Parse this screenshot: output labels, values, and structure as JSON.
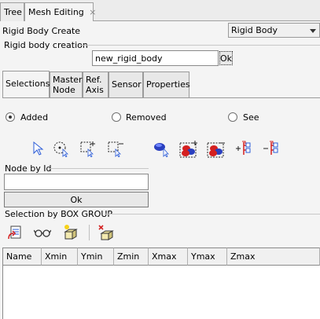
{
  "tabs": [
    {
      "label": "Tree"
    },
    {
      "label": "Mesh Editing",
      "close": "×"
    }
  ],
  "header": {
    "title": "Rigid Body Create",
    "type_select": {
      "value": "Rigid Body"
    }
  },
  "creation": {
    "group_label": "Rigid body creation",
    "name_value": "new_rigid_body",
    "ok_label": "Ok"
  },
  "subtabs": [
    {
      "label": "Selections"
    },
    {
      "label": "Master Node"
    },
    {
      "label": "Ref. Axis"
    },
    {
      "label": "Sensor"
    },
    {
      "label": "Properties"
    }
  ],
  "selection_mode": {
    "options": [
      {
        "label": "Added",
        "selected": true
      },
      {
        "label": "Removed",
        "selected": false
      },
      {
        "label": "See",
        "selected": false
      }
    ]
  },
  "toolbar_icons": [
    "select-arrow-icon",
    "select-point-icon",
    "box-add-icon",
    "box-remove-icon",
    "pick-part-icon",
    "add-part-icon",
    "remove-part-icon",
    "add-tree-icon",
    "remove-tree-icon"
  ],
  "node_by_id": {
    "label": "Node by Id",
    "input_value": "",
    "ok_label": "Ok"
  },
  "box_group": {
    "label": "Selection by BOX GROUP",
    "icons": [
      "import-box-icon",
      "view-box-icon",
      "new-box-icon",
      "delete-box-icon"
    ],
    "columns": [
      "Name",
      "Xmin",
      "Ymin",
      "Zmin",
      "Xmax",
      "Ymax",
      "Zmax"
    ],
    "rows": []
  },
  "colors": {
    "panel_bg": "#f4f4f4",
    "accent_blue": "#2a5bd7",
    "accent_red": "#d42020"
  }
}
